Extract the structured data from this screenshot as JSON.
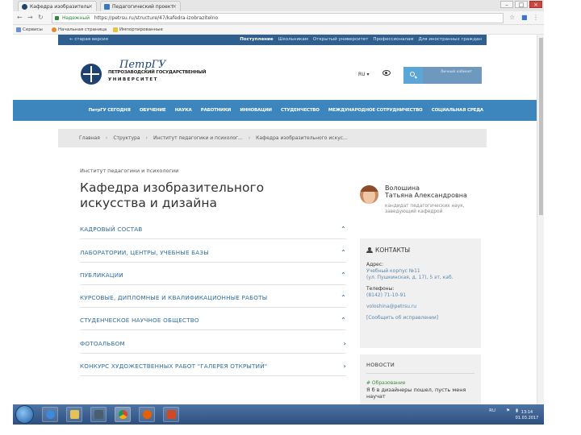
{
  "browser": {
    "tabs": [
      {
        "label": "Кафедра изобразитель"
      },
      {
        "label": "Педагогический проект"
      }
    ],
    "url_secure": "Надежный",
    "url": "https://petrsu.ru/structure/47/kafedra-izobrazitelno",
    "bookmarks": [
      "Сервисы",
      "Начальная страница",
      "Импортированные"
    ]
  },
  "site": {
    "back_link": "← старая версия",
    "top_links": [
      "Поступление",
      "Школьникам",
      "Открытый университет",
      "Профессионалам",
      "Для иностранных граждан"
    ],
    "logo_script": "ПетрГУ",
    "logo_line1": "ПЕТРОЗАВОДСКИЙ ГОСУДАРСТВЕННЫЙ",
    "logo_line2": "УНИВЕРСИТЕТ",
    "lang": "RU ▾",
    "personal": "Личный кабинет"
  },
  "main_nav": [
    "ПетрГУ СЕГОДНЯ",
    "ОБУЧЕНИЕ",
    "НАУКА",
    "РАБОТНИКИ",
    "ИННОВАЦИИ",
    "СТУДЕНЧЕСТВО",
    "МЕЖДУНАРОДНОЕ СОТРУДНИЧЕСТВО",
    "СОЦИАЛЬНАЯ СРЕДА"
  ],
  "breadcrumbs": [
    "Главная",
    "Структура",
    "Институт педагогики и психолог...",
    "Кафедра изобразительного искус..."
  ],
  "page": {
    "institute": "Институт педагогики и психологии",
    "title": "Кафедра изобразительного искусства и дизайна",
    "sections": [
      {
        "label": "КАДРОВЫЙ СОСТАВ",
        "chev": "⌃"
      },
      {
        "label": "ЛАБОРАТОРИИ, ЦЕНТРЫ, УЧЕБНЫЕ БАЗЫ",
        "chev": "⌃"
      },
      {
        "label": "ПУБЛИКАЦИИ",
        "chev": "⌃"
      },
      {
        "label": "КУРСОВЫЕ, ДИПЛОМНЫЕ И КВАЛИФИКАЦИОННЫЕ РАБОТЫ",
        "chev": "⌃"
      },
      {
        "label": "СТУДЕНЧЕСКОЕ НАУЧНОЕ ОБЩЕСТВО",
        "chev": "⌃"
      },
      {
        "label": "ФОТОАЛЬБОМ",
        "chev": "›"
      },
      {
        "label": "КОНКУРС ХУДОЖЕСТВЕННЫХ РАБОТ \"ГАЛЕРЕЯ ОТКРЫТИЙ\"",
        "chev": "›"
      }
    ]
  },
  "person": {
    "surname": "Волошина",
    "name": "Татьяна Александровна",
    "role": "кандидат педагогических наук, заведующий кафедрой"
  },
  "contacts": {
    "heading": "КОНТАКТЫ",
    "address_label": "Адрес:",
    "address_1": "Учебный корпус №11",
    "address_2": "(ул. Пушкинская, д. 17), 5 эт, каб.",
    "phone_label": "Телефоны:",
    "phone": "(8142) 71-10-91",
    "email": "voloshina@petrsu.ru",
    "report": "[Сообщить об исправлении]"
  },
  "news": {
    "heading": "НОВОСТИ",
    "category": "# Образование",
    "text": "Я б в дизайнеры пошел, пусть меня научат"
  },
  "taskbar": {
    "tray": "RU",
    "time": "13:14",
    "date": "01.03.2017"
  }
}
